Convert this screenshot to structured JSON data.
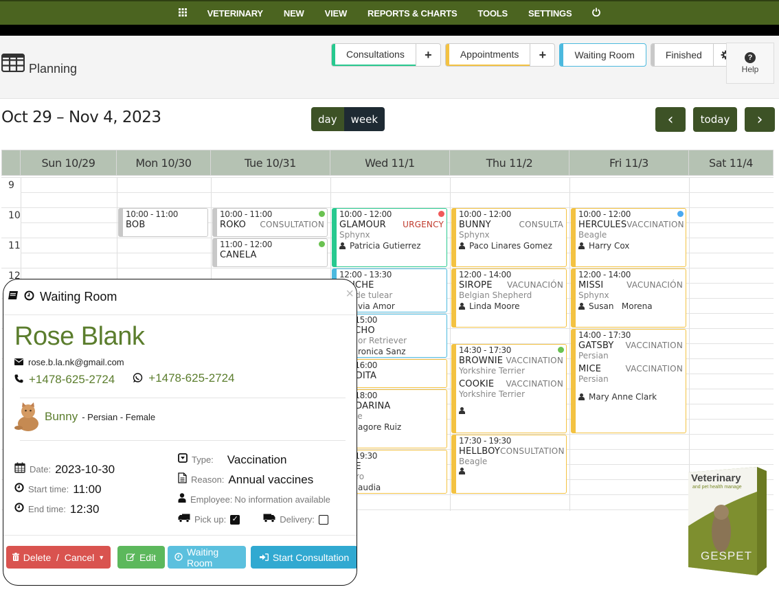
{
  "topnav": {
    "items": [
      "VETERINARY",
      "NEW",
      "VIEW",
      "REPORTS & CHARTS",
      "TOOLS",
      "SETTINGS"
    ],
    "brand_color": "#4b6420"
  },
  "header": {
    "title": "Planning",
    "tabs": {
      "consultations": "Consultations",
      "appointments": "Appointments",
      "waiting_room": "Waiting Room",
      "finished": "Finished",
      "plus": "+",
      "help": "Help"
    },
    "tab_colors": {
      "consultations": "#27c98f",
      "appointments": "#f3c242",
      "waiting_room": "#4bb9de",
      "finished": "#c8c8c8"
    }
  },
  "toolbar": {
    "range": "Oct 29 – Nov 4, 2023",
    "day": "day",
    "week": "week",
    "prev": "‹",
    "today": "today",
    "next": "›"
  },
  "calendar": {
    "days": [
      "Sun 10/29",
      "Mon 10/30",
      "Tue 10/31",
      "Wed 11/1",
      "Thu 11/2",
      "Fri 11/3",
      "Sat 11/4"
    ],
    "hours": [
      "9",
      "10",
      "11",
      "12"
    ],
    "events": [
      {
        "day": 1,
        "time": "10:00 - 11:00",
        "name": "BOB",
        "color": "gray"
      },
      {
        "day": 2,
        "time": "10:00 - 11:00",
        "name": "ROKO",
        "type": "CONSULTATION",
        "color": "gray",
        "dot": "#6ac251"
      },
      {
        "day": 2,
        "time": "11:00 - 12:00",
        "name": "CANELA",
        "color": "gray",
        "dot": "#6ac251"
      },
      {
        "day": 3,
        "time": "10:00 - 12:00",
        "name": "GLAMOUR",
        "type": "URGENCY",
        "breed": "Sphynx",
        "owner": "Patricia Gutierrez",
        "color": "green",
        "dot": "#f05a5a"
      },
      {
        "day": 3,
        "time": "12:00 - 13:30",
        "name": "…UCHE",
        "breed": "…a de tulear",
        "owner": "…via Amor",
        "color": "blue"
      },
      {
        "day": 3,
        "time": "… - 15:00",
        "name": "…ACHO",
        "breed": "…ador Retriever",
        "owner": "…ronica Sanz",
        "color": "blue"
      },
      {
        "day": 3,
        "time": "… - 16:00",
        "name": "…ODITA",
        "color": "yellow"
      },
      {
        "day": 3,
        "time": "… - 18:00",
        "name": "…NDARINA",
        "breed": "…che",
        "owner": "…agore Ruiz",
        "color": "yellow"
      },
      {
        "day": 3,
        "time": "… - 19:30",
        "name": "…DE",
        "breed": "…rero",
        "owner": "…audia",
        "color": "yellow"
      },
      {
        "day": 4,
        "time": "10:00 - 12:00",
        "name": "BUNNY",
        "type": "CONSULTA",
        "breed": "Sphynx",
        "owner": "Paco Linares Gomez",
        "color": "yellow"
      },
      {
        "day": 4,
        "time": "12:00 - 14:00",
        "name": "SIROPE",
        "type": "VACUNACIÓN",
        "breed": "Belgian Shepherd",
        "owner": "Linda Moore",
        "color": "yellow"
      },
      {
        "day": 4,
        "time": "14:30 - 17:30",
        "name": "BROWNIE",
        "type": "VACCINATION",
        "breed": "Yorkshire Terrier",
        "name2": "COOKIE",
        "type2": "VACCINATION",
        "breed2": "Yorkshire Terrier",
        "owner": "",
        "color": "yellow",
        "dot": "#6ac251"
      },
      {
        "day": 4,
        "time": "17:30 - 19:30",
        "name": "HELLBOY",
        "type": "CONSULTATION",
        "breed": "Beagle",
        "owner": "",
        "color": "yellow"
      },
      {
        "day": 5,
        "time": "10:00 - 12:00",
        "name": "HERCULES",
        "type": "VACCINATION",
        "breed": "Beagle",
        "owner": "Harry Cox",
        "color": "yellow",
        "dot": "#4aa9ef"
      },
      {
        "day": 5,
        "time": "12:00 - 14:00",
        "name": "MISSI",
        "type": "VACUNACIÓN",
        "breed": "Sphynx",
        "owner": "Susan   Morena",
        "color": "yellow"
      },
      {
        "day": 5,
        "time": "14:00 - 17:30",
        "name": "GATSBY",
        "type": "VACCINATION",
        "breed": "Persian",
        "name2": "MICE",
        "type2": "VACCINATION",
        "breed2": "Persian",
        "owner": "Mary Anne Clark",
        "color": "yellow"
      }
    ]
  },
  "modal": {
    "title": "Waiting Room",
    "close": "×",
    "client_name": "Rose Blank",
    "email": "rose.b.la.nk@gmail.com",
    "phone": "+1478-625-2724",
    "whatsapp": "+1478-625-2724",
    "pet_name": "Bunny",
    "pet_desc": " - Persian - Female",
    "date_label": "Date:",
    "date": "2023-10-30",
    "start_label": "Start time:",
    "start": "11:00",
    "end_label": "End time:",
    "end": "12:30",
    "type_label": "Type:",
    "type": "Vaccination",
    "reason_label": "Reason:",
    "reason": "Annual vaccines",
    "employee_label": "Employee:",
    "employee": "No information available",
    "pickup_label": "Pick up:",
    "pickup_checked": true,
    "delivery_label": "Delivery:",
    "delivery_checked": false,
    "buttons": {
      "delete": "Delete  /  Cancel",
      "edit": "Edit",
      "waiting": "Waiting Room",
      "start": "Start Consultation"
    }
  },
  "product": {
    "title": "Veterinary",
    "subtitle": "and pet health manage",
    "brand": "GESPET",
    "side": "Veterinary and pet health manage"
  }
}
